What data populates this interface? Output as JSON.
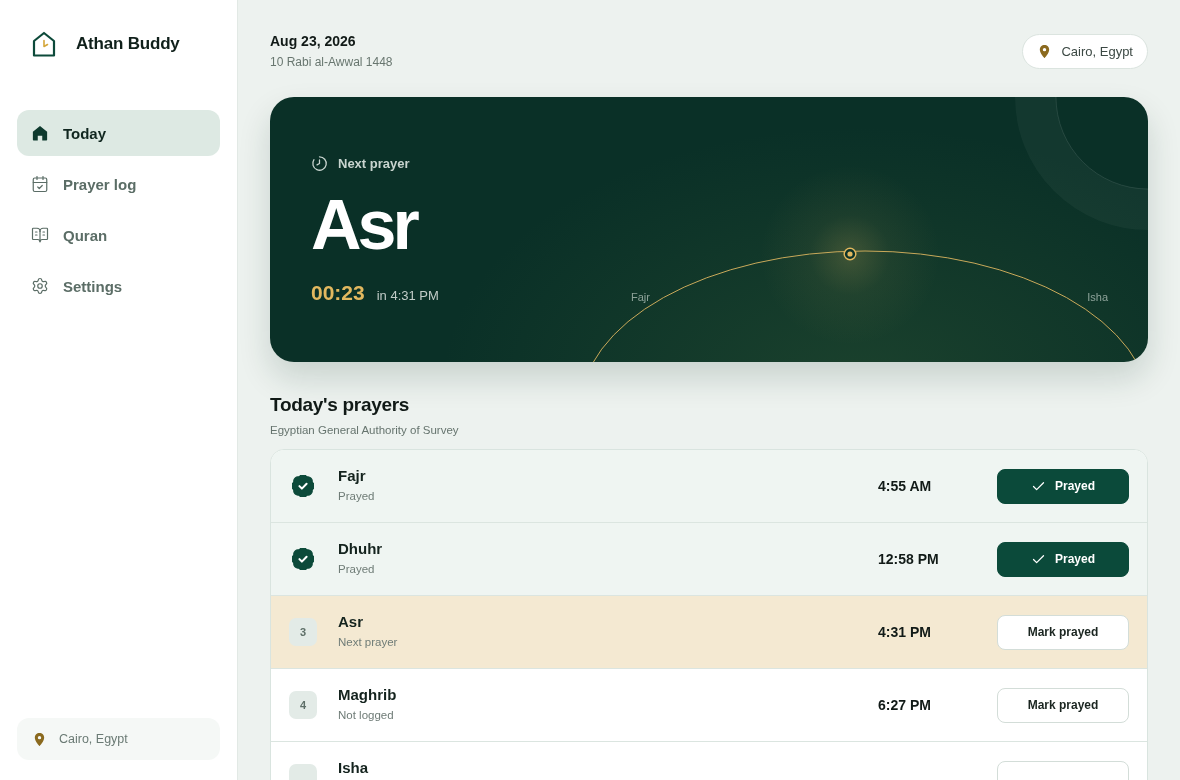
{
  "sidebar": {
    "brand": "Athan Buddy",
    "items": [
      {
        "label": "Today",
        "selected": true
      },
      {
        "label": "Prayer log",
        "selected": false
      },
      {
        "label": "Quran",
        "selected": false
      },
      {
        "label": "Settings",
        "selected": false
      }
    ],
    "location": "Cairo, Egypt"
  },
  "header": {
    "date": "Aug 23, 2026",
    "hijri_date": "10 Rabi al-Awwal 1448",
    "location": "Cairo, Egypt"
  },
  "next_prayer": {
    "label": "Next prayer",
    "name": "Asr",
    "countdown": "00:23",
    "at": "in 4:31 PM",
    "arc_start": "Fajr",
    "arc_end": "Isha"
  },
  "prayers": {
    "title": "Today's prayers",
    "method": "Egyptian General Authority of Survey",
    "rows": [
      {
        "kind": "prayed",
        "name": "Fajr",
        "status": "Prayed",
        "time": "4:55 AM",
        "action": "Prayed"
      },
      {
        "kind": "prayed",
        "name": "Dhuhr",
        "status": "Prayed",
        "time": "12:58 PM",
        "action": "Prayed"
      },
      {
        "kind": "next",
        "number": "3",
        "name": "Asr",
        "status": "Next prayer",
        "time": "4:31 PM",
        "action": "Mark prayed"
      },
      {
        "kind": "pending",
        "number": "4",
        "name": "Maghrib",
        "status": "Not logged",
        "time": "6:27 PM",
        "action": "Mark prayed"
      },
      {
        "kind": "pending",
        "name": "Isha"
      }
    ]
  }
}
